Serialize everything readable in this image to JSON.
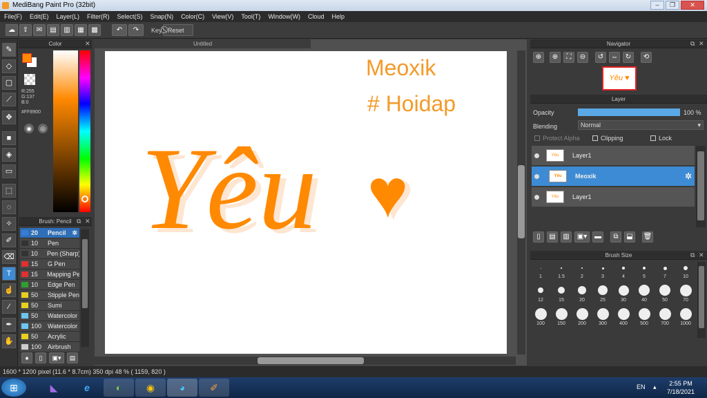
{
  "app": {
    "title": "MediBang Paint Pro (32bit)"
  },
  "menu": [
    "File(F)",
    "Edit(E)",
    "Layer(L)",
    "Filter(R)",
    "Select(S)",
    "Snap(N)",
    "Color(C)",
    "View(V)",
    "Tool(T)",
    "Window(W)",
    "Cloud",
    "Help"
  ],
  "toolbar": {
    "key_label": "Key",
    "reset_label": "Reset"
  },
  "color_panel": {
    "title": "Color",
    "r": "R:255",
    "g": "G:137",
    "b": "B:0",
    "hex": "#FF8900",
    "fg": "#FF8900",
    "bg": "#FFFFFF"
  },
  "brush_panel": {
    "title": "Brush: Pencil",
    "brushes": [
      {
        "size": "20",
        "name": "Pencil",
        "color": "#3a7bd5",
        "selected": true
      },
      {
        "size": "10",
        "name": "Pen",
        "color": "#333333"
      },
      {
        "size": "10",
        "name": "Pen (Sharp)",
        "color": "#333333"
      },
      {
        "size": "15",
        "name": "G Pen",
        "color": "#e03030"
      },
      {
        "size": "15",
        "name": "Mapping Pe",
        "color": "#e03030"
      },
      {
        "size": "10",
        "name": "Edge Pen",
        "color": "#2fa02f"
      },
      {
        "size": "50",
        "name": "Stipple Pen",
        "color": "#e8d020"
      },
      {
        "size": "50",
        "name": "Sumi",
        "color": "#e8d020"
      },
      {
        "size": "50",
        "name": "Watercolor",
        "color": "#6ec6f0"
      },
      {
        "size": "100",
        "name": "Watercolor",
        "color": "#6ec6f0"
      },
      {
        "size": "50",
        "name": "Acrylic",
        "color": "#e8d020"
      },
      {
        "size": "100",
        "name": "Airbrush",
        "color": "#cccccc"
      }
    ]
  },
  "canvas": {
    "tab": "Untitled",
    "text1": "Meoxik",
    "text2": "# Hoidap",
    "art_text": "Yêu",
    "art_color": "#FF8900"
  },
  "navigator": {
    "title": "Navigator",
    "thumb_text": "Yêu ♥"
  },
  "layer_panel": {
    "title": "Layer",
    "opacity_label": "Opacity",
    "opacity_value": "100 %",
    "opacity": 1.0,
    "blending_label": "Blending",
    "blending_value": "Normal",
    "protect_alpha": "Protect Alpha",
    "clipping": "Clipping",
    "lock": "Lock",
    "layers": [
      {
        "name": "Layer1",
        "selected": false
      },
      {
        "name": "Meoxik",
        "selected": true
      },
      {
        "name": "Layer1",
        "selected": false
      }
    ]
  },
  "brush_size_panel": {
    "title": "Brush Size",
    "sizes": [
      "1",
      "1.5",
      "2",
      "3",
      "4",
      "5",
      "7",
      "10",
      "12",
      "15",
      "20",
      "25",
      "30",
      "40",
      "50",
      "70",
      "100",
      "150",
      "200",
      "300",
      "400",
      "500",
      "700",
      "1000"
    ]
  },
  "status": {
    "text": "1600 * 1200 pixel   (11.6 * 8.7cm)   350 dpi   48 %   ( 1159, 820 )"
  },
  "taskbar": {
    "lang": "EN",
    "time": "2:55 PM",
    "date": "7/18/2021"
  }
}
